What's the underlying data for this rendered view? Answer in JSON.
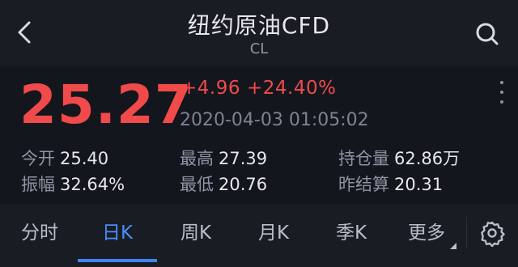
{
  "header": {
    "back_icon": "chevron-left-icon",
    "title": "纽约原油CFD",
    "subtitle": "CL",
    "search_icon": "search-icon"
  },
  "quote": {
    "price": "25.27",
    "change": "+4.96",
    "change_pct": "+24.40%",
    "timestamp": "2020-04-03 01:05:02",
    "more_icon": "more-vertical-icon",
    "colors": {
      "up": "#f04a4a",
      "label": "#8e94a3",
      "value": "#e6e8ee",
      "accent": "#3f83f8"
    }
  },
  "stats": [
    {
      "label": "今开",
      "value": "25.40"
    },
    {
      "label": "最高",
      "value": "27.39"
    },
    {
      "label": "持仓量",
      "value": "62.86万"
    },
    {
      "label": "振幅",
      "value": "32.64%"
    },
    {
      "label": "最低",
      "value": "20.76"
    },
    {
      "label": "昨结算",
      "value": "20.31"
    }
  ],
  "tabs": [
    {
      "label": "分时",
      "active": false
    },
    {
      "label": "日K",
      "active": true
    },
    {
      "label": "周K",
      "active": false
    },
    {
      "label": "月K",
      "active": false
    },
    {
      "label": "季K",
      "active": false
    },
    {
      "label": "更多",
      "active": false
    }
  ],
  "settings_icon": "gear-icon"
}
